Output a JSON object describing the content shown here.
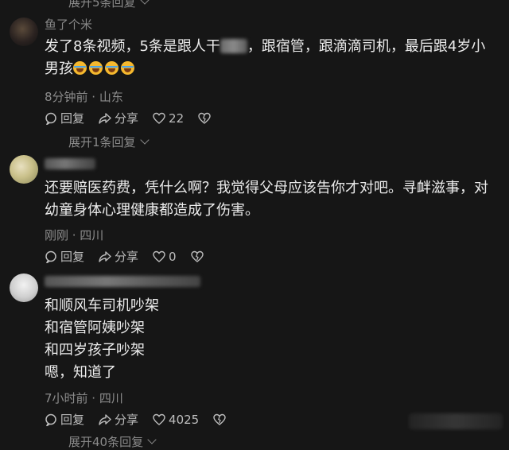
{
  "top_expand": {
    "label": "展开5条回复"
  },
  "comments": [
    {
      "username": "鱼了个米",
      "text_prefix": "发了8条视频，5条是跟人干",
      "text_suffix": "，跟宿管，跟滴滴司机，最后跟4岁小男孩",
      "emoji_count": 4,
      "meta": "8分钟前 · 山东",
      "reply_label": "回复",
      "share_label": "分享",
      "likes": "22"
    },
    {
      "username": "",
      "text": "还要赔医药费，凭什么啊？我觉得父母应该告你才对吧。寻衅滋事，对幼童身体心理健康都造成了伤害。",
      "meta": "刚刚 · 四川",
      "reply_label": "回复",
      "share_label": "分享",
      "likes": "0"
    },
    {
      "username": "",
      "lines": [
        "和顺风车司机吵架",
        "和宿管阿姨吵架",
        "和四岁孩子吵架",
        "嗯，知道了"
      ],
      "meta": "7小时前 · 四川",
      "reply_label": "回复",
      "share_label": "分享",
      "likes": "4025"
    }
  ],
  "mid_expand": {
    "label": "展开1条回复"
  },
  "bottom_expand": {
    "label": "展开40条回复"
  },
  "icons": {
    "reply": "reply-bubble-icon",
    "share": "share-arrow-icon",
    "like": "heart-icon",
    "dislike": "broken-heart-icon",
    "chevron": "chevron-down-icon"
  },
  "colors": {
    "background": "#161616",
    "text": "#ececec",
    "muted": "#8c8c8c"
  }
}
